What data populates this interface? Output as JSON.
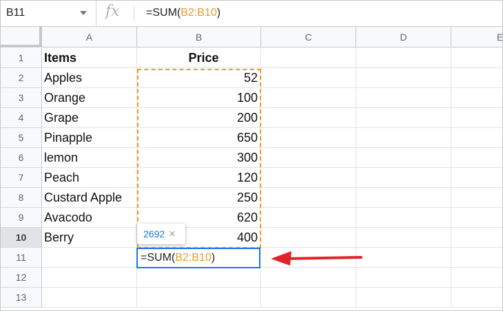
{
  "name_box": "B11",
  "fx_symbol": "fx",
  "formula": {
    "prefix": "=SUM(",
    "range": "B2:B10",
    "suffix": ")"
  },
  "columns": [
    "A",
    "B",
    "C",
    "D",
    "E"
  ],
  "rows": [
    "1",
    "2",
    "3",
    "4",
    "5",
    "6",
    "7",
    "8",
    "9",
    "10",
    "11",
    "12",
    "13"
  ],
  "cells": {
    "A1": "Items",
    "B1": "Price",
    "A2": "Apples",
    "B2": "52",
    "A3": "Orange",
    "B3": "100",
    "A4": "Grape",
    "B4": "200",
    "A5": "Pinapple",
    "B5": "650",
    "A6": "lemon",
    "B6": "300",
    "A7": "Peach",
    "B7": "120",
    "A8": "Custard Apple",
    "B8": "250",
    "A9": "Avacodo",
    "B9": "620",
    "A10": "Berry",
    "B10": "400"
  },
  "active_cell_input": {
    "prefix": "=SUM(",
    "range": "B2:B10",
    "suffix": ")"
  },
  "result_tooltip": {
    "value": "2692",
    "close": "×"
  },
  "colors": {
    "range_highlight": "#f29a1f",
    "selection": "#1a73e8",
    "arrow": "#e0242a"
  }
}
